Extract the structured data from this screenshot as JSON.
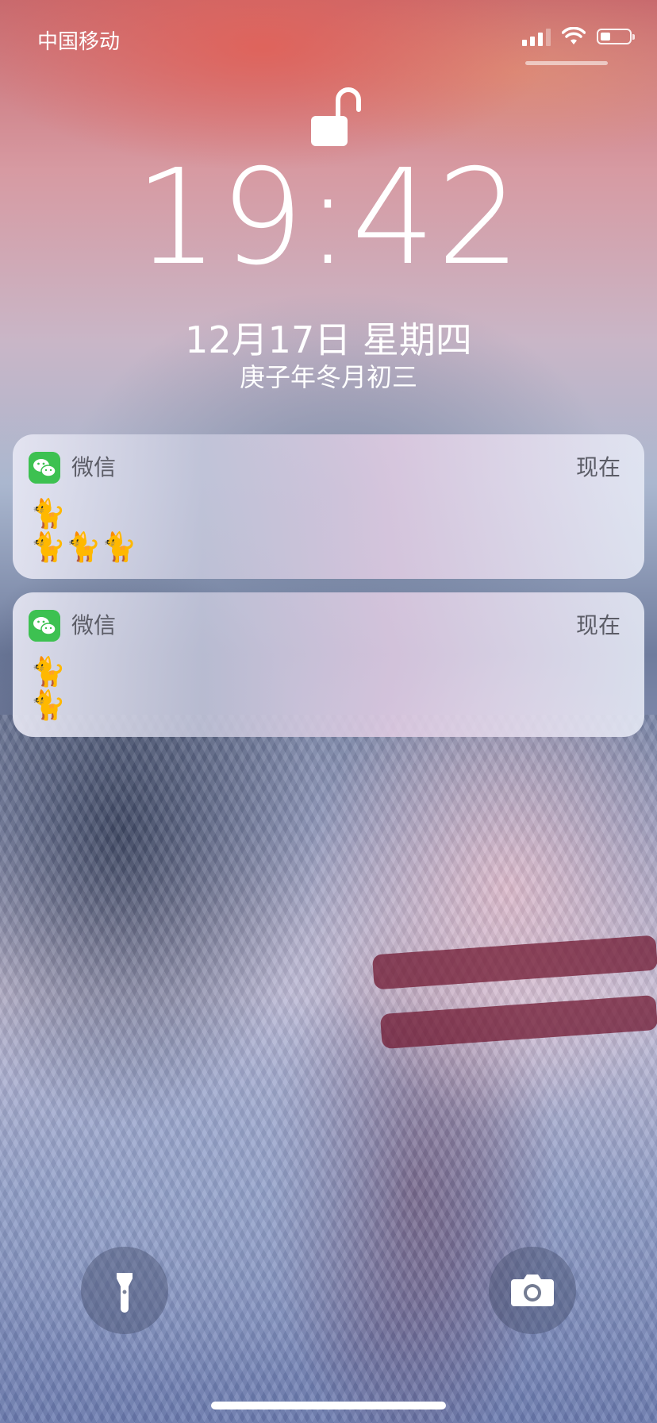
{
  "status_bar": {
    "carrier": "中国移动",
    "signal_bars": 3,
    "battery_level": 0.35
  },
  "lock_screen": {
    "time": "19:42",
    "date": "12月17日 星期四",
    "lunar_date": "庚子年冬月初三",
    "lock_icon": "unlocked-padlock-icon"
  },
  "notifications": [
    {
      "app": "微信",
      "time": "现在",
      "icon": "wechat-icon",
      "lines": [
        "🐈",
        "🐈🐈🐈"
      ]
    },
    {
      "app": "微信",
      "time": "现在",
      "icon": "wechat-icon",
      "lines": [
        "🐈",
        "🐈"
      ]
    }
  ],
  "quick_actions": {
    "flashlight_icon": "flashlight-icon",
    "camera_icon": "camera-icon"
  },
  "colors": {
    "wechat_green": "#3dc151",
    "text_white": "#ffffff",
    "notification_text": "#5b5c66"
  }
}
